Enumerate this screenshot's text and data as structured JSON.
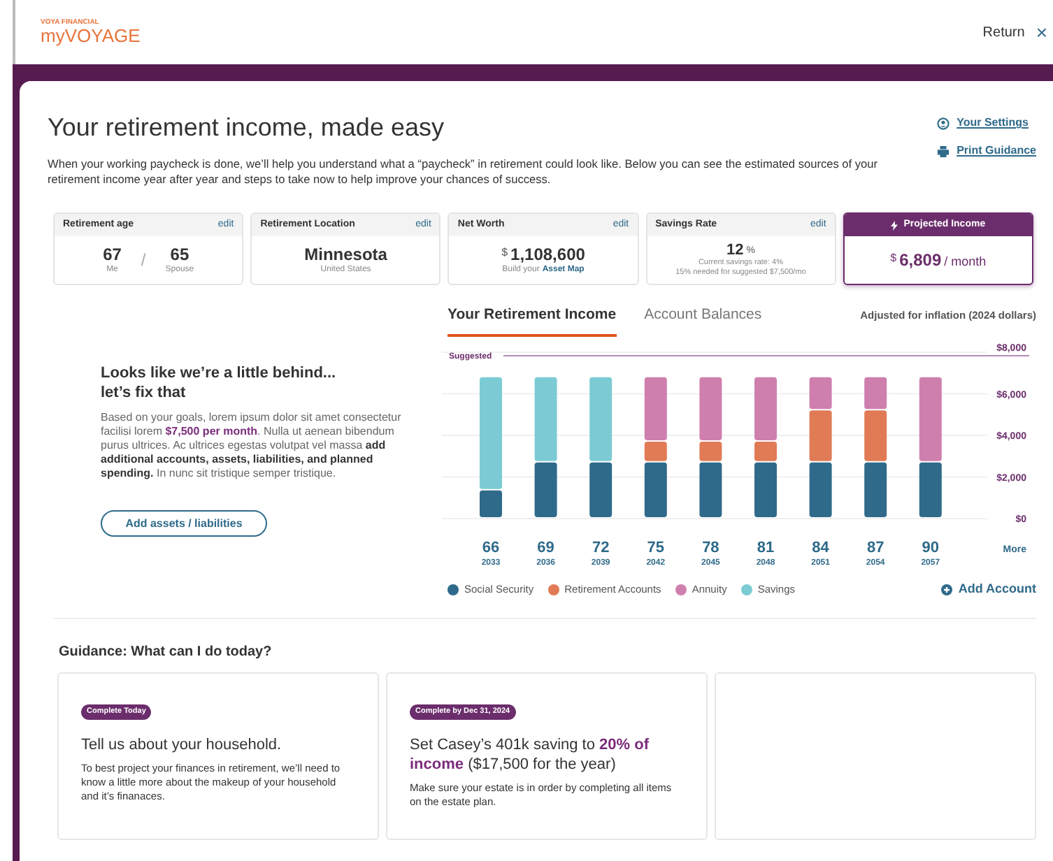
{
  "header": {
    "brand_small": "VOYA FINANCIAL",
    "brand": "myVOYAGE",
    "return": "Return",
    "close": "×"
  },
  "page": {
    "title": "Your retirement income, made easy",
    "intro": "When your working paycheck is done, we’ll help you understand what a “paycheck” in retirement could look like. Below you can see the estimated sources of your retirement income year after year and steps to take now to help improve your chances of success.",
    "links": [
      {
        "kind": "settings",
        "label": "Your Settings"
      },
      {
        "kind": "print",
        "label": "Print Guidance"
      }
    ]
  },
  "stats": [
    {
      "kind": "ages",
      "title": "Retirement age",
      "edit": "edit",
      "values": [
        {
          "value": "67",
          "caption": "Me"
        },
        {
          "value": "65",
          "caption": "Spouse"
        }
      ],
      "separator": "/"
    },
    {
      "kind": "location",
      "title": "Retirement Location",
      "edit": "edit",
      "value": "Minnesota",
      "caption": "United States"
    },
    {
      "kind": "networth",
      "title": "Net Worth",
      "edit": "edit",
      "currency": "$",
      "value": "1,108,600",
      "caption": "Build your",
      "link": "Asset Map"
    },
    {
      "kind": "savings",
      "title": "Savings Rate",
      "edit": "edit",
      "value": "12",
      "unit": "%",
      "lines": [
        "Current savings rate: 4%",
        "15% needed for suggested $7,500/mo"
      ]
    },
    {
      "kind": "projected",
      "title": "Projected Income",
      "currency": "$",
      "value": "6,809",
      "unit": "/ month",
      "selected": true
    }
  ],
  "promo": {
    "title": "Looks like we’re a little behind... let’s fix that",
    "body": "Based on your goals, lorem ipsum dolor sit amet consectetur facilisi lorem **$7,500 per month**. Nulla ut aenean bibendum purus ultrices. Ac ultrices egestas volutpat vel massa **add additional accounts, assets, liabilities, and planned spending.** In nunc sit tristique semper tristique.",
    "button": "Add assets / liabilities"
  },
  "tabs": [
    {
      "label": "Your Retirement Income",
      "selected": true
    },
    {
      "label": "Account Balances",
      "selected": false
    }
  ],
  "inflation_note": "Adjusted for inflation (2024 dollars)",
  "chart": {
    "chart_data": {
      "type": "bar",
      "stacked": true,
      "categories": [
        "66",
        "69",
        "72",
        "75",
        "78",
        "81",
        "84",
        "87",
        "90"
      ],
      "series": [
        {
          "name": "Social Security",
          "color": "#2f6a8a",
          "values": [
            1350,
            2700,
            2700,
            2700,
            2700,
            2700,
            2700,
            2700,
            2700
          ]
        },
        {
          "name": "Retirement Accounts",
          "color": "#e07b55",
          "values": [
            0,
            0,
            0,
            1000,
            1000,
            1000,
            2500,
            2500,
            0
          ]
        },
        {
          "name": "Annuity",
          "color": "#cf7fae",
          "values": [
            0,
            0,
            0,
            3100,
            3100,
            3100,
            1600,
            1600,
            4100
          ]
        },
        {
          "name": "Savings",
          "color": "#7ccbd4",
          "values": [
            5450,
            4100,
            4100,
            0,
            0,
            0,
            0,
            0,
            0
          ]
        }
      ],
      "ylim": [
        0,
        8000
      ],
      "yticks": [
        {
          "value": 0,
          "label": "$0"
        },
        {
          "value": 2000,
          "label": "$2,000"
        },
        {
          "value": 4000,
          "label": "$4,000"
        },
        {
          "value": 6000,
          "label": "$6,000"
        },
        {
          "value": 8000,
          "label": "$8,000"
        }
      ],
      "grid": true
    },
    "suggested_label": "Suggested",
    "years": [
      "2033",
      "2036",
      "2039",
      "2042",
      "2045",
      "2048",
      "2051",
      "2054",
      "2057"
    ],
    "more": "More"
  },
  "add_account": "Add Account",
  "guidance": {
    "title": "Guidance: What can I do today?",
    "cards": [
      {
        "badge": "Complete Today",
        "title": "Tell us about your household.",
        "body": "To best project your finances in retirement, we’ll need to know a little more about the makeup of your household and it’s finanaces."
      },
      {
        "badge": "Complete by Dec 31, 2024",
        "title": "Set Casey’s 401k saving to **20% of income** ($17,500 for the year)",
        "body": "Make sure your estate is in order by completing all items on the estate plan."
      }
    ]
  }
}
